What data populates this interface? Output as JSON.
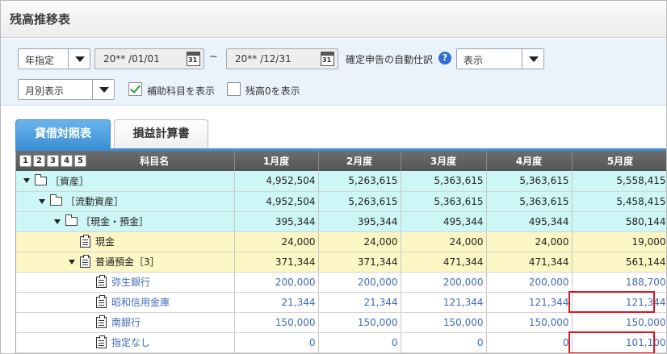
{
  "title": "残高推移表",
  "filters": {
    "period_type": "年指定",
    "date_from": "20** /01/01",
    "date_to": "20** /12/31",
    "tilde": "~",
    "calendar_icon_text": "31",
    "auto_journal_label": "確定申告の自動仕訳",
    "auto_journal_value": "表示",
    "display_mode": "月別表示",
    "show_sub_accounts_label": "補助科目を表示",
    "show_sub_accounts_checked": true,
    "show_zero_label": "残高0を表示",
    "show_zero_checked": false
  },
  "tabs": [
    {
      "label": "貸借対照表",
      "active": true
    },
    {
      "label": "損益計算書",
      "active": false
    }
  ],
  "table": {
    "level_buttons": [
      "1",
      "2",
      "3",
      "4",
      "5"
    ],
    "headers": [
      "科目名",
      "1月度",
      "2月度",
      "3月度",
      "4月度",
      "5月度"
    ],
    "rows": [
      {
        "name": "［資産］",
        "level": 0,
        "kind": "folder",
        "style": "cyan",
        "values": [
          "4,952,504",
          "5,263,615",
          "5,363,615",
          "5,363,615",
          "5,558,415"
        ]
      },
      {
        "name": "［流動資産］",
        "level": 1,
        "kind": "folder",
        "style": "cyan",
        "values": [
          "4,952,504",
          "5,263,615",
          "5,363,615",
          "5,363,615",
          "5,458,415"
        ]
      },
      {
        "name": "［現金・預金］",
        "level": 2,
        "kind": "folder",
        "style": "cyan",
        "values": [
          "395,344",
          "395,344",
          "495,344",
          "495,344",
          "580,144"
        ]
      },
      {
        "name": "現金",
        "level": 3,
        "kind": "ledger",
        "style": "yellow",
        "values": [
          "24,000",
          "24,000",
          "24,000",
          "24,000",
          "19,000"
        ]
      },
      {
        "name": "普通預金［3］",
        "level": 3,
        "kind": "ledger-expand",
        "style": "yellow",
        "values": [
          "371,344",
          "371,344",
          "471,344",
          "471,344",
          "561,144"
        ]
      },
      {
        "name": "弥生銀行",
        "level": 4,
        "kind": "ledger",
        "style": "leaf",
        "values": [
          "200,000",
          "200,000",
          "200,000",
          "200,000",
          "188,700"
        ]
      },
      {
        "name": "昭和信用金庫",
        "level": 4,
        "kind": "ledger",
        "style": "leaf",
        "values": [
          "21,344",
          "21,344",
          "121,344",
          "121,344",
          "121,344"
        ]
      },
      {
        "name": "南銀行",
        "level": 4,
        "kind": "ledger",
        "style": "leaf",
        "values": [
          "150,000",
          "150,000",
          "150,000",
          "150,000",
          "150,000"
        ]
      },
      {
        "name": "指定なし",
        "level": 4,
        "kind": "ledger",
        "style": "leaf",
        "values": [
          "0",
          "0",
          "0",
          "0",
          "101,100"
        ]
      }
    ]
  },
  "colors": {
    "accent": "#3c8fd6",
    "highlight": "#e0141e",
    "leaf_text": "#3f6cb6"
  }
}
